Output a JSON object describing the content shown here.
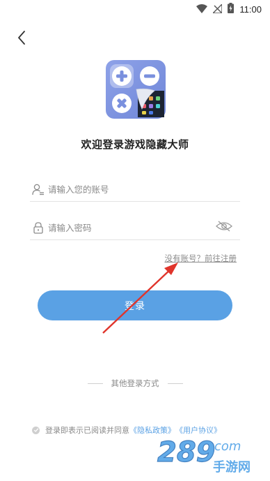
{
  "status_bar": {
    "time": "11:00",
    "icons": [
      "wifi-icon",
      "no-signal-icon",
      "battery-charging-icon"
    ]
  },
  "back_icon": "chevron-left-icon",
  "app_title": "欢迎登录游戏隐藏大师",
  "account_field": {
    "placeholder": "请输入您的账号",
    "value": "",
    "icon": "user-icon"
  },
  "password_field": {
    "placeholder": "请输入密码",
    "value": "",
    "icon": "lock-icon",
    "toggle_icon": "eye-hidden-icon"
  },
  "register_link": "没有账号？前往注册",
  "login_button": "登录",
  "other_login": "其他登录方式",
  "agreement": {
    "prefix": "登录即表示已阅读并同意",
    "privacy": "《隐私政策》",
    "user": "《用户协议》"
  },
  "watermark": {
    "brand": "289",
    "domain": "com",
    "sub": "手游网"
  },
  "colors": {
    "accent": "#5aa1e4",
    "arrow": "#e0342b",
    "muted_text": "#8a8a8a"
  }
}
